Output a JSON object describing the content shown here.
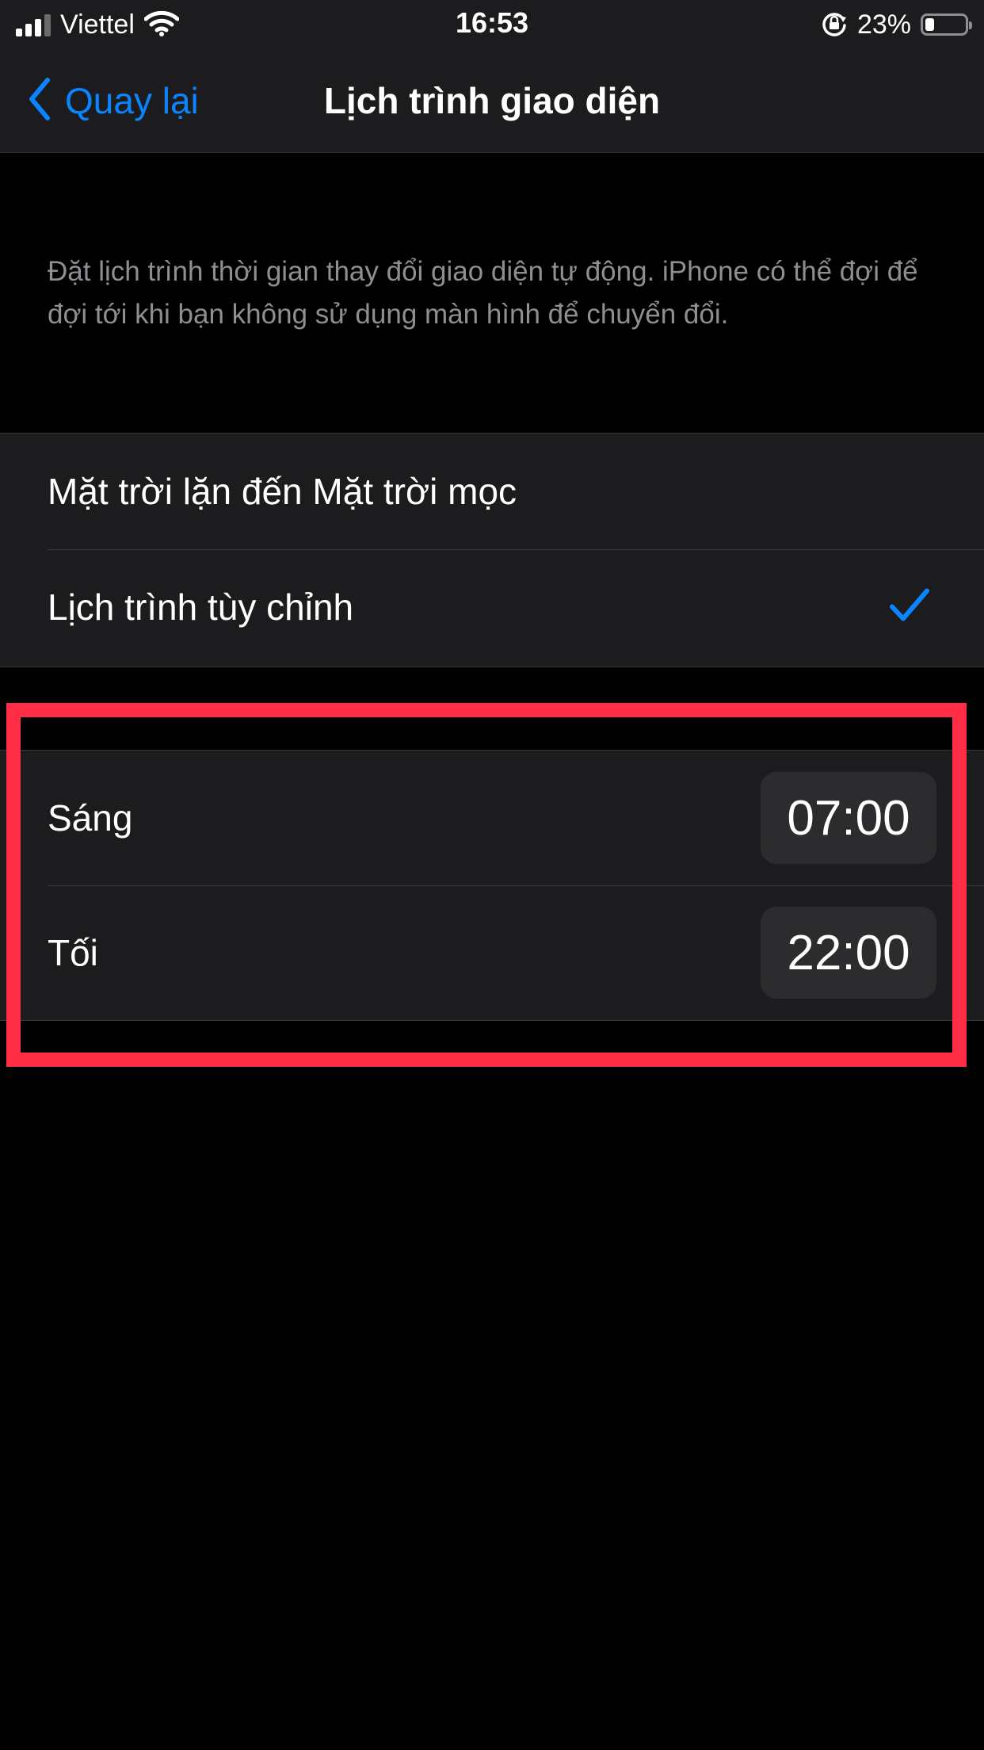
{
  "status_bar": {
    "carrier": "Viettel",
    "time": "16:53",
    "battery": "23%",
    "battery_level": 0.23
  },
  "nav": {
    "back_label": "Quay lại",
    "title": "Lịch trình giao diện"
  },
  "description": "Đặt lịch trình thời gian thay đổi giao diện tự động. iPhone có thể đợi để đợi tới khi bạn không sử dụng màn hình để chuyển đổi.",
  "modes": [
    {
      "label": "Mặt trời lặn đến Mặt trời mọc",
      "selected": false
    },
    {
      "label": "Lịch trình tùy chỉnh",
      "selected": true
    }
  ],
  "schedule": {
    "morning_label": "Sáng",
    "morning_time": "07:00",
    "evening_label": "Tối",
    "evening_time": "22:00"
  },
  "colors": {
    "accent": "#0a84ff",
    "highlight": "#ff2d46",
    "cell_background": "#1c1c1e",
    "secondary_text": "#8e8e93"
  },
  "icons": {
    "back": "chevron-left-icon",
    "check": "checkmark-icon",
    "wifi": "wifi-icon",
    "rotation_lock": "rotation-lock-icon"
  }
}
